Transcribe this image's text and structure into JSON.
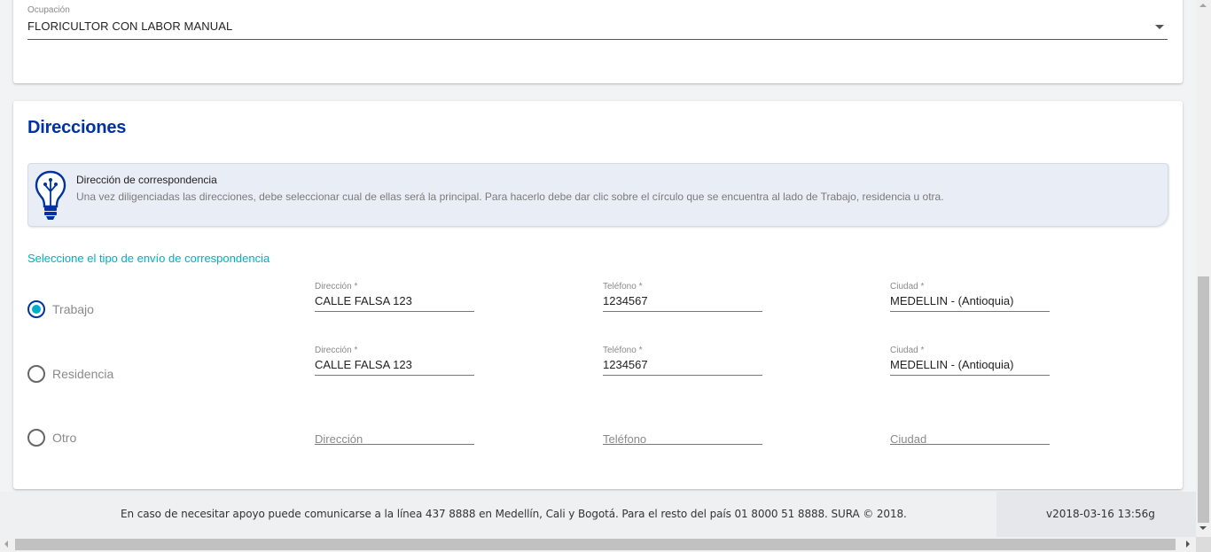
{
  "occupation": {
    "label": "Ocupación",
    "value": "FLORICULTOR CON LABOR MANUAL"
  },
  "addresses": {
    "title": "Direcciones",
    "info": {
      "title": "Dirección de correspondencia",
      "text": "Una vez diligenciadas las direcciones, debe seleccionar cual de ellas será la principal. Para hacerlo debe dar clic sobre el círculo que se encuentra al lado de Trabajo, residencia u otra."
    },
    "select_label": "Seleccione el tipo de envío de correspondencia",
    "rows": [
      {
        "label": "Trabajo",
        "checked": true,
        "address": {
          "label": "Dirección *",
          "value": "CALLE FALSA 123"
        },
        "phone": {
          "label": "Teléfono *",
          "value": "1234567"
        },
        "city": {
          "label": "Ciudad *",
          "value": "MEDELLIN - (Antioquia)"
        }
      },
      {
        "label": "Residencia",
        "checked": false,
        "address": {
          "label": "Dirección *",
          "value": "CALLE FALSA 123"
        },
        "phone": {
          "label": "Teléfono *",
          "value": "1234567"
        },
        "city": {
          "label": "Ciudad *",
          "value": "MEDELLIN - (Antioquia)"
        }
      },
      {
        "label": "Otro",
        "checked": false,
        "address": {
          "placeholder": "Dirección"
        },
        "phone": {
          "placeholder": "Teléfono"
        },
        "city": {
          "placeholder": "Ciudad"
        }
      }
    ]
  },
  "footer": {
    "text": "En caso de necesitar apoyo puede comunicarse a la línea 437 8888 en Medellín, Cali y Bogotá. Para el resto del país 01 8000 51 8888. SURA © 2018.",
    "version": "v2018-03-16 13:56g"
  },
  "colors": {
    "title": "#0033a0",
    "accent": "#00aec7",
    "background": "#f1f3f5"
  },
  "icons": [
    "chevron-down-icon",
    "lightbulb-icon",
    "radio-checked-icon",
    "radio-unchecked-icon"
  ]
}
